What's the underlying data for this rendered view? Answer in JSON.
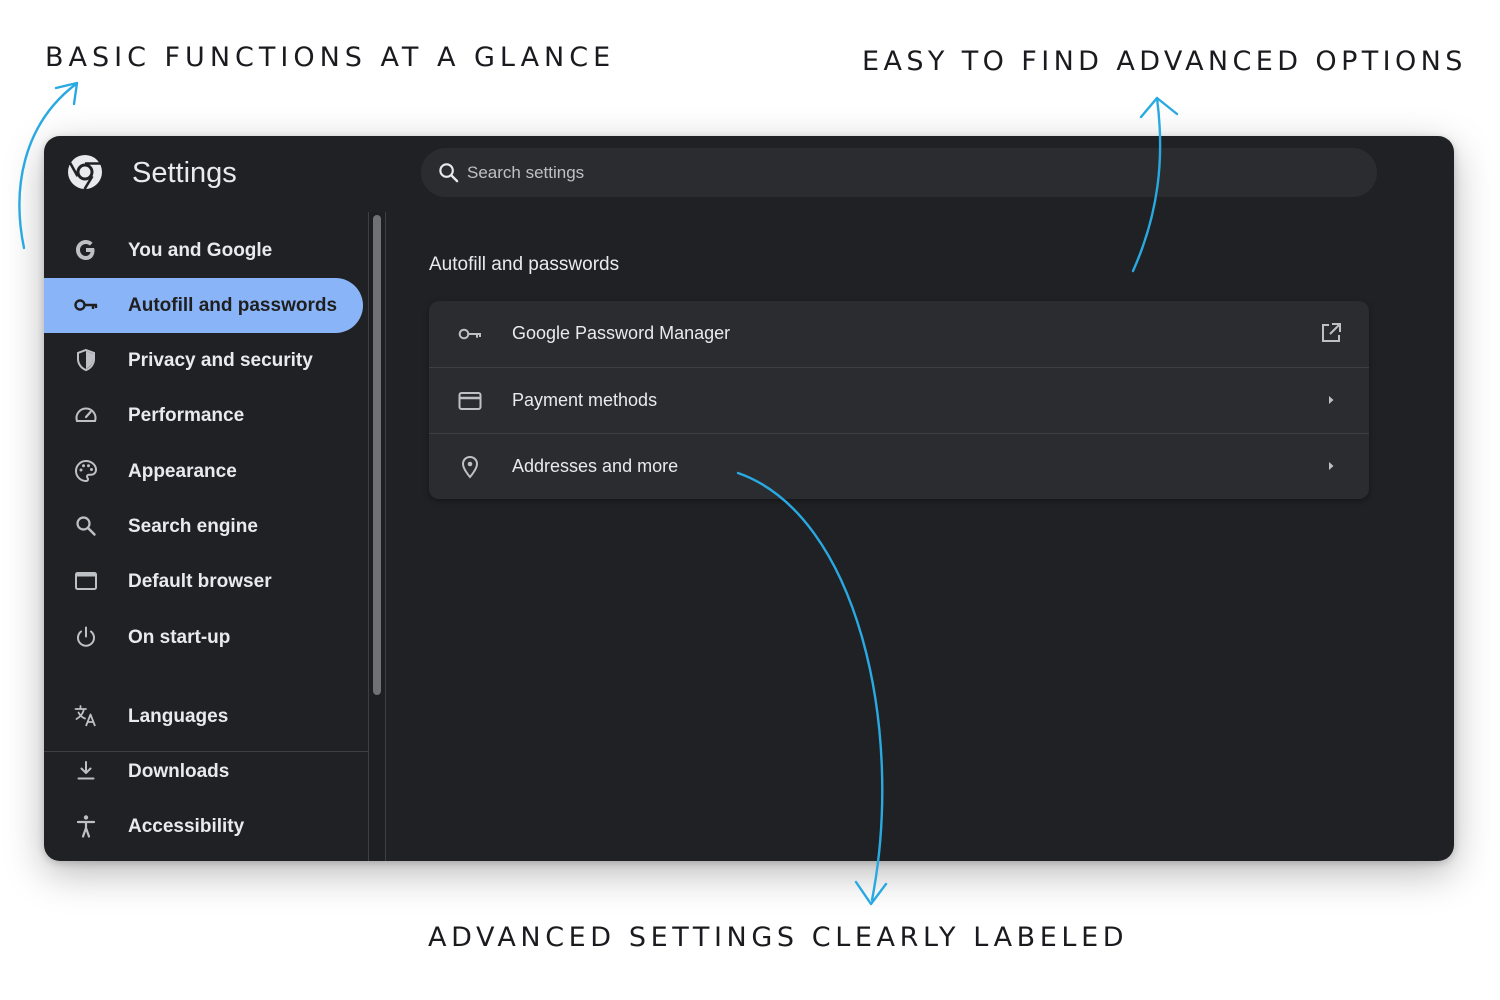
{
  "captions": {
    "top_left": "BASIC FUNCTIONS AT A GLANCE",
    "top_right": "EASY TO FIND ADVANCED OPTIONS",
    "bottom": "ADVANCED SETTINGS CLEARLY LABELED"
  },
  "colors": {
    "annotation_arrow": "#29a9e1",
    "window_background": "#202124",
    "active_nav": "#8ab4f8",
    "card_background": "#2b2c30"
  },
  "header": {
    "logo_icon": "chrome-logo-icon",
    "title": "Settings",
    "search": {
      "placeholder": "Search settings",
      "value": "",
      "icon": "search-icon"
    }
  },
  "sidebar": {
    "items": [
      {
        "label": "You and Google",
        "icon": "google-g-icon",
        "active": false
      },
      {
        "label": "Autofill and passwords",
        "icon": "key-icon",
        "active": true
      },
      {
        "label": "Privacy and security",
        "icon": "shield-icon",
        "active": false
      },
      {
        "label": "Performance",
        "icon": "speedometer-icon",
        "active": false
      },
      {
        "label": "Appearance",
        "icon": "palette-icon",
        "active": false
      },
      {
        "label": "Search engine",
        "icon": "search-icon",
        "active": false
      },
      {
        "label": "Default browser",
        "icon": "browser-window-icon",
        "active": false
      },
      {
        "label": "On start-up",
        "icon": "power-icon",
        "active": false
      },
      {
        "label": "Languages",
        "icon": "translate-icon",
        "active": false
      },
      {
        "label": "Downloads",
        "icon": "download-icon",
        "active": false
      },
      {
        "label": "Accessibility",
        "icon": "accessibility-icon",
        "active": false
      }
    ]
  },
  "main": {
    "section_title": "Autofill and passwords",
    "rows": [
      {
        "label": "Google Password Manager",
        "icon": "key-icon",
        "action_icon": "open-in-new-icon"
      },
      {
        "label": "Payment methods",
        "icon": "credit-card-icon",
        "action_icon": "chevron-right-icon"
      },
      {
        "label": "Addresses and more",
        "icon": "location-pin-icon",
        "action_icon": "chevron-right-icon"
      }
    ]
  }
}
